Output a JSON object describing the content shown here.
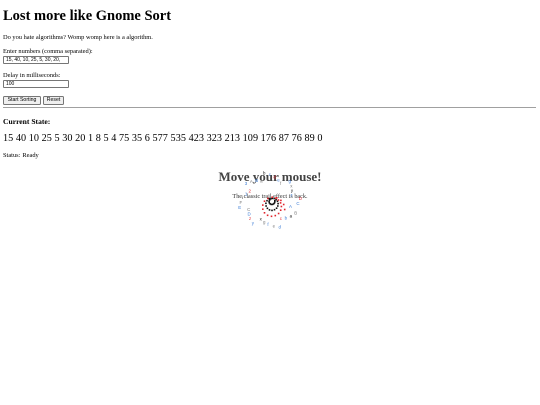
{
  "page": {
    "title": "Lost more like Gnome Sort",
    "intro": "Do you hate algorithms? Womp womp here is a algorithm."
  },
  "form": {
    "numbers_label": "Enter numbers (comma separated):",
    "numbers_value": "15, 40, 10, 25, 5, 30, 20,",
    "delay_label": "Delay in milliseconds:",
    "delay_value": "100",
    "start_label": "Start Sorting",
    "reset_label": "Reset"
  },
  "state": {
    "heading": "Current State:",
    "array_text": "15 40 10 25 5 30 20 1 8 5 4 75 35 6 577 535 423 323 213 109 176 87 76 89 0",
    "status_label": "Status:",
    "status_value": "Ready"
  },
  "overlay": {
    "banner": "Move your mouse!",
    "subtext": "The classic trail effect is back.",
    "trail_letters": [
      "A",
      "B",
      "a",
      "b",
      "c",
      "d",
      "e",
      "f",
      "g",
      "x",
      "y",
      "z",
      "D",
      "C",
      "E",
      "F",
      "i",
      "1",
      "2",
      "3"
    ],
    "colors": {
      "blue": "#3a7bd5",
      "red": "#e0242c",
      "black": "#111111",
      "gray": "#777777"
    }
  }
}
